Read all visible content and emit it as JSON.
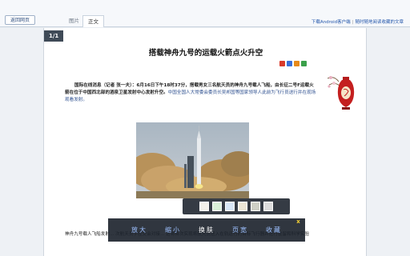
{
  "topbar": {
    "back_label": "返回网页",
    "tabs": [
      {
        "label": "图片",
        "active": false
      },
      {
        "label": "正文",
        "active": true
      }
    ],
    "right_link_1": "下载Android客户端",
    "right_link_2": "随时随地阅读收藏的文章"
  },
  "page": {
    "page_indicator": "1/1",
    "title": "搭载神舟九号的运载火箭点火升空",
    "paragraph_lead": "国际在线消息（记者 张一夫）：6月16日下午18时37分，搭载男女三名航天员的神舟九号载人飞船，由长征二号F运载火箭在位于中国西北部的酒泉卫星发射中心发射升空。",
    "paragraph_tail": "中国全国人大常委会委员长吴邦国等国家领导人此前为飞行员送行并在现场观看发射。",
    "bottom_text": "神舟九号载人飞船发射... 次航天员手控交会对接... 这将首次实现将航天员送入在轨运行的目标飞行器并进行驻留和科学实验"
  },
  "share_icons": [
    {
      "name": "share-red-icon",
      "color": "#d93a2b"
    },
    {
      "name": "share-blue-icon",
      "color": "#3a6fd9"
    },
    {
      "name": "share-orange-icon",
      "color": "#e88a1a"
    },
    {
      "name": "share-green-icon",
      "color": "#3aa04a"
    }
  ],
  "swatch_colors": [
    "#f3f1ea",
    "#d9efd7",
    "#d8e6f6",
    "#ece6d6",
    "#cfd0c6",
    "#dcdcdc"
  ],
  "toolbar": {
    "tools": [
      {
        "label": "放大",
        "active": false
      },
      {
        "label": "缩小",
        "active": false
      },
      {
        "label": "换肤",
        "active": true
      },
      {
        "label": "页宽",
        "active": false
      },
      {
        "label": "收藏",
        "active": false
      }
    ],
    "close_label": "x"
  },
  "colors": {
    "toolbar_bg": "#19202a",
    "tool_text": "#9dc0ff",
    "close_color": "#ffd633"
  }
}
